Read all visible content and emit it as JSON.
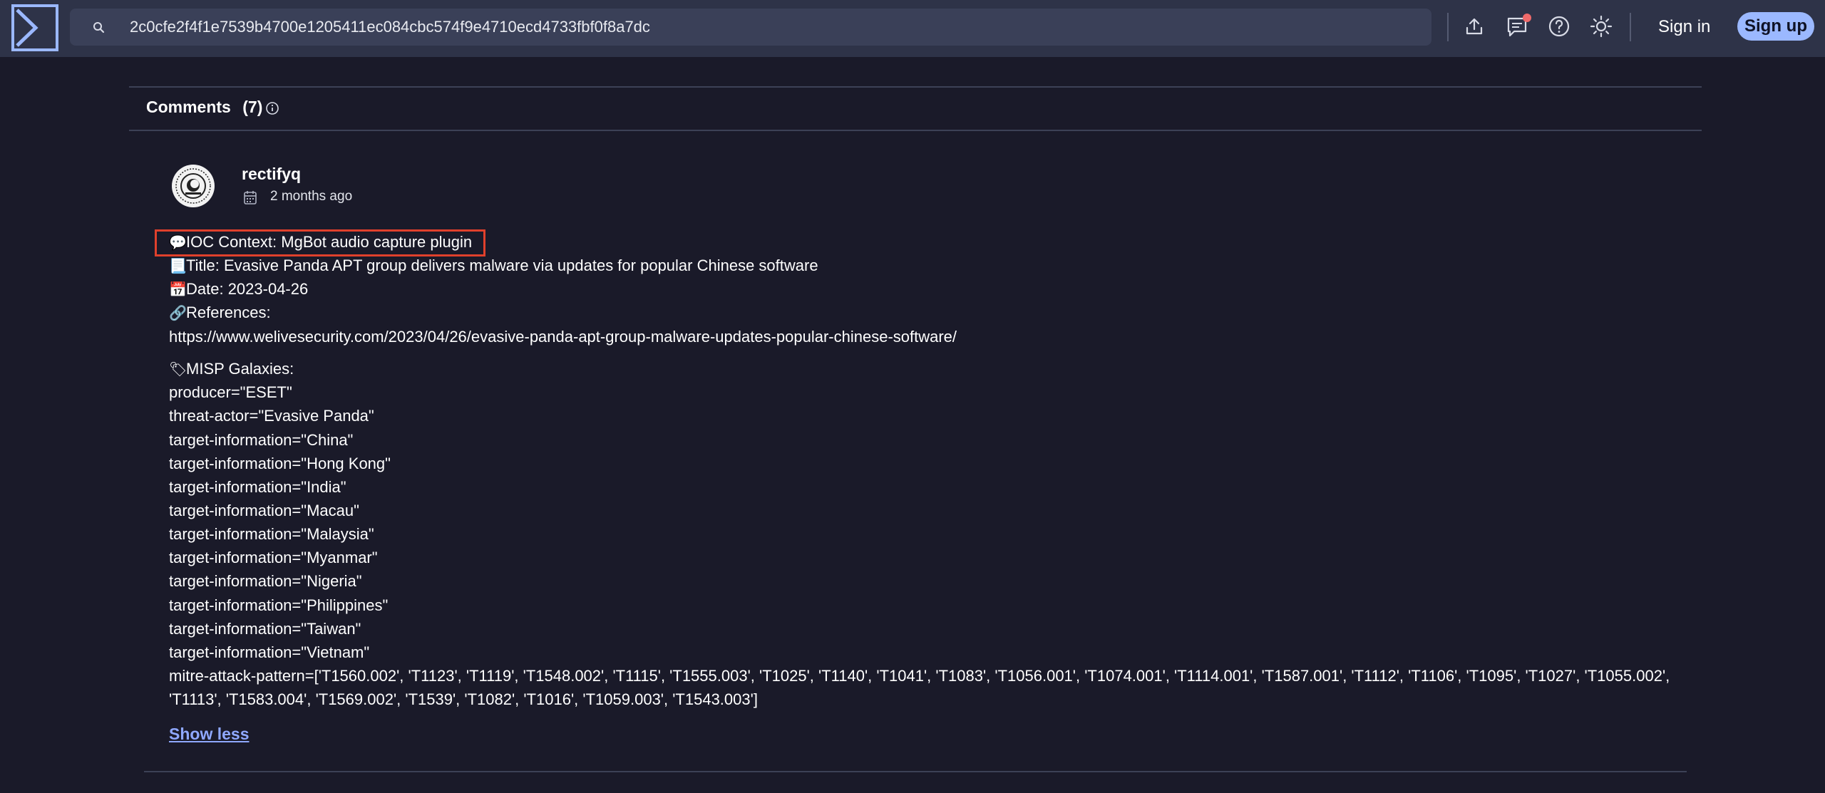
{
  "search": {
    "value": "2c0cfe2f4f1e7539b4700e1205411ec084cbc574f9e4710ecd4733fbf0f8a7dc"
  },
  "auth": {
    "signin_label": "Sign in",
    "signup_label": "Sign up"
  },
  "icons": {
    "logo": "sigma-logo-icon",
    "search": "search-icon",
    "upload": "upload-icon",
    "chat": "chat-icon",
    "help": "help-icon",
    "theme": "sun-icon",
    "info": "info-icon",
    "calendar": "calendar-icon"
  },
  "colors": {
    "topbar": "#2e3348",
    "background": "#1a1a29",
    "accent": "#9bb8ff",
    "link": "#8fa8ff",
    "highlight": "#e0402c",
    "notification": "#ef6a6a"
  },
  "comments": {
    "title": "Comments",
    "count": "(7)"
  },
  "comment": {
    "username": "rectifyq",
    "time": "2 months ago",
    "emojis": {
      "context": "💬",
      "title": "📃",
      "date": "📅",
      "references": "🔗",
      "misp": "🏷"
    },
    "ioc_context": "IOC Context: MgBot audio capture plugin",
    "title": "Title: Evasive Panda APT group delivers malware via updates for popular Chinese software",
    "date": "Date: 2023-04-26",
    "references_label": "References:",
    "reference_url": "https://www.welivesecurity.com/2023/04/26/evasive-panda-apt-group-malware-updates-popular-chinese-software/",
    "misp_label": "MISP Galaxies:",
    "galaxies": [
      "producer=\"ESET\"",
      "threat-actor=\"Evasive Panda\"",
      "target-information=\"China\"",
      "target-information=\"Hong Kong\"",
      "target-information=\"India\"",
      "target-information=\"Macau\"",
      "target-information=\"Malaysia\"",
      "target-information=\"Myanmar\"",
      "target-information=\"Nigeria\"",
      "target-information=\"Philippines\"",
      "target-information=\"Taiwan\"",
      "target-information=\"Vietnam\""
    ],
    "mitre_line1": "mitre-attack-pattern=['T1560.002', 'T1123', 'T1119', 'T1548.002', 'T1115', 'T1555.003', 'T1025', 'T1140', 'T1041', 'T1083', 'T1056.001', 'T1074.001', 'T1114.001', 'T1587.001', 'T1112', 'T1106', 'T1095', 'T1027', 'T1055.002',",
    "mitre_line2": "'T1113', 'T1583.004', 'T1569.002', 'T1539', 'T1082', 'T1016', 'T1059.003', 'T1543.003']",
    "show_less": "Show less"
  }
}
